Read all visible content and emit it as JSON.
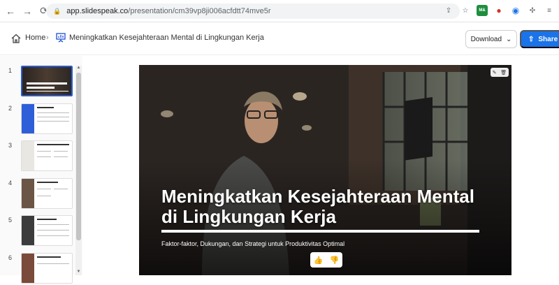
{
  "browser": {
    "back": "←",
    "forward": "→",
    "reload": "⟳",
    "url_host": "app.slidespeak.co",
    "url_path": "/presentation/cm39vp8ji006acfdtt74mve5r",
    "extensions": [
      "share-icon",
      "star-icon",
      "spreadsheet-extension-icon",
      "recorder-extension-icon",
      "sync-extension-icon",
      "puzzle-icon",
      "playlist-icon"
    ]
  },
  "header": {
    "home_label": "Home",
    "separator": "›",
    "presentation_title": "Meningkatkan Kesejahteraan Mental di Lingkungan Kerja",
    "download_label": "Download",
    "share_label": "Share",
    "accent_color": "#1a73e8"
  },
  "sidebar": {
    "slides": [
      {
        "number": "1",
        "active": true
      },
      {
        "number": "2",
        "active": false
      },
      {
        "number": "3",
        "active": false
      },
      {
        "number": "4",
        "active": false
      },
      {
        "number": "5",
        "active": false
      },
      {
        "number": "6",
        "active": false
      }
    ]
  },
  "slide": {
    "title_line1": "Meningkatkan Kesejahteraan Mental",
    "title_line2": "di Lingkungan Kerja",
    "subtitle": "Faktor-faktor, Dukungan, dan Strategi untuk Produktivitas Optimal"
  }
}
